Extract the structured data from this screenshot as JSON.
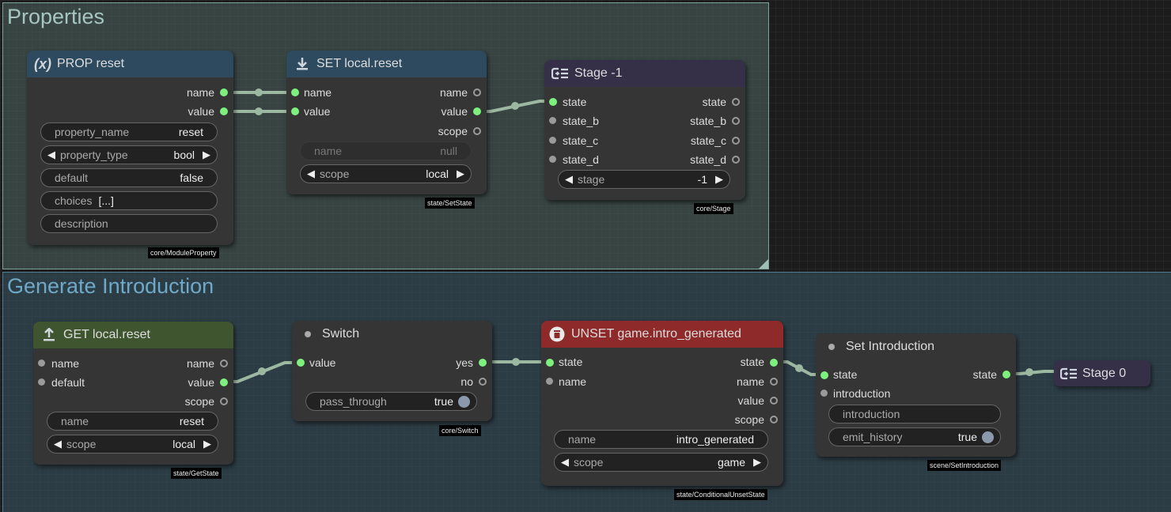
{
  "groups": {
    "properties": {
      "title": "Properties"
    },
    "generate_introduction": {
      "title": "Generate Introduction"
    }
  },
  "nodes": {
    "prop_reset": {
      "icon": "(x)",
      "title": "PROP reset",
      "outputs": [
        "name",
        "value"
      ],
      "widgets": {
        "property_name": {
          "label": "property_name",
          "value": "reset"
        },
        "property_type": {
          "label": "property_type",
          "value": "bool"
        },
        "default": {
          "label": "default",
          "value": "false"
        },
        "choices": {
          "label": "choices",
          "value": "[...]"
        },
        "description": {
          "label": "description",
          "value": ""
        }
      },
      "tag": "core/ModuleProperty"
    },
    "set_local_reset": {
      "title": "SET local.reset",
      "inputs": [
        "name",
        "value"
      ],
      "outputs": [
        "name",
        "value",
        "scope"
      ],
      "widgets": {
        "name": {
          "label": "name",
          "value": "null"
        },
        "scope": {
          "label": "scope",
          "value": "local"
        }
      },
      "tag": "state/SetState"
    },
    "stage_neg1": {
      "title": "Stage -1",
      "inputs": [
        "state",
        "state_b",
        "state_c",
        "state_d"
      ],
      "outputs": [
        "state",
        "state_b",
        "state_c",
        "state_d"
      ],
      "widgets": {
        "stage": {
          "label": "stage",
          "value": "-1"
        }
      },
      "tag": "core/Stage"
    },
    "get_local_reset": {
      "title": "GET local.reset",
      "inputs": [
        "name",
        "default"
      ],
      "outputs": [
        "name",
        "value",
        "scope"
      ],
      "widgets": {
        "name": {
          "label": "name",
          "value": "reset"
        },
        "scope": {
          "label": "scope",
          "value": "local"
        }
      },
      "tag": "state/GetState"
    },
    "switch": {
      "title": "Switch",
      "inputs": [
        "value"
      ],
      "outputs": [
        "yes",
        "no"
      ],
      "widgets": {
        "pass_through": {
          "label": "pass_through",
          "value": "true"
        }
      },
      "tag": "core/Switch"
    },
    "unset": {
      "title": "UNSET game.intro_generated",
      "inputs": [
        "state",
        "name"
      ],
      "outputs": [
        "state",
        "name",
        "value",
        "scope"
      ],
      "widgets": {
        "name": {
          "label": "name",
          "value": "intro_generated"
        },
        "scope": {
          "label": "scope",
          "value": "game"
        }
      },
      "tag": "state/ConditionalUnsetState"
    },
    "set_intro": {
      "title": "Set Introduction",
      "inputs": [
        "state",
        "introduction"
      ],
      "outputs": [
        "state"
      ],
      "widgets": {
        "introduction": {
          "label": "introduction",
          "value": ""
        },
        "emit_history": {
          "label": "emit_history",
          "value": "true"
        }
      },
      "tag": "scene/SetIntroduction"
    },
    "stage_0": {
      "title": "Stage 0"
    }
  },
  "colors": {
    "socket_connected": "#7ef07e",
    "socket_unconnected": "#9a9a9a",
    "wire": "#9db8a0",
    "header_prop": "#2d4a5f",
    "header_set": "#2d4a5f",
    "header_stage": "#353048",
    "header_get": "#3f5530",
    "header_unset": "#8f2a2a"
  }
}
